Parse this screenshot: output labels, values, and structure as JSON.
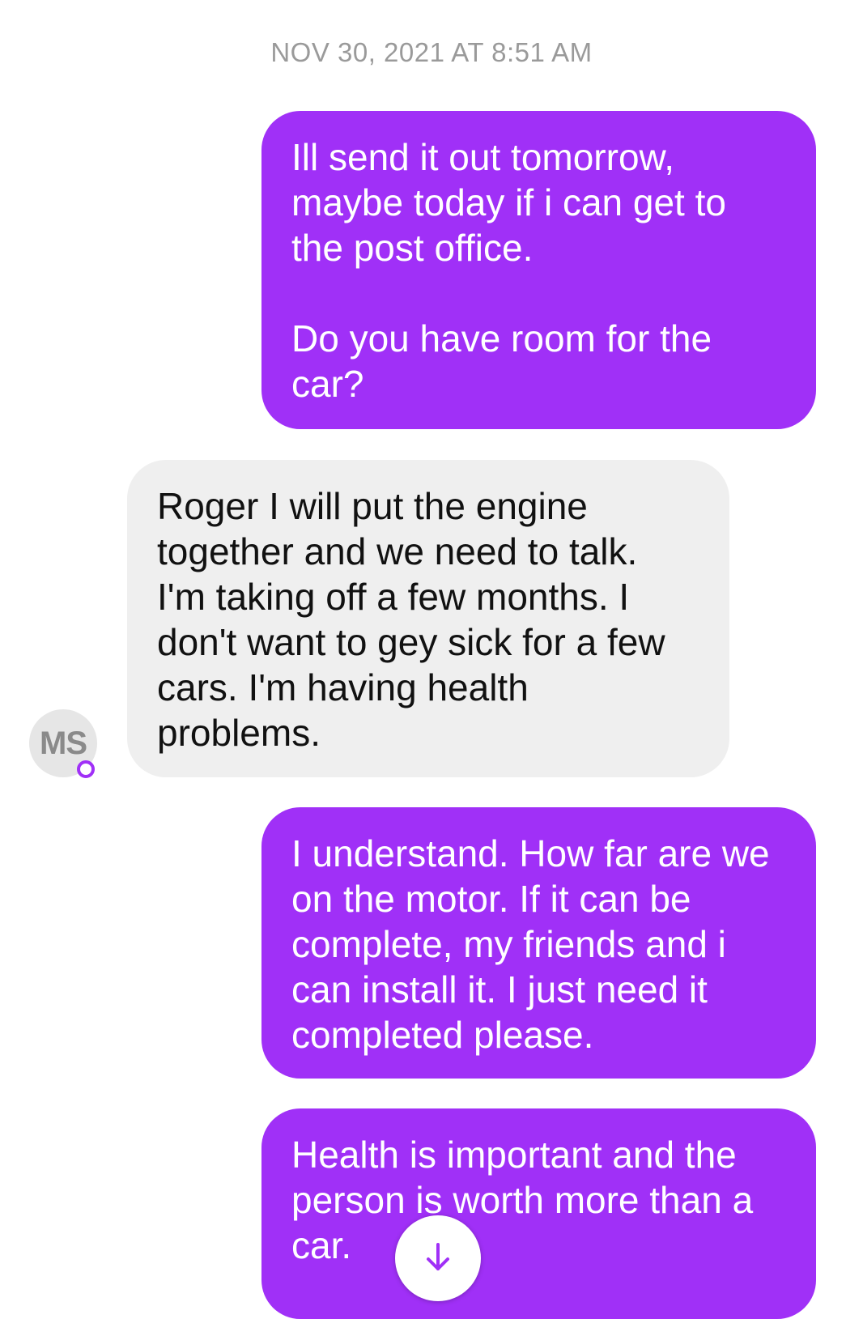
{
  "conversation": {
    "timestamp": "NOV 30, 2021 AT 8:51 AM",
    "messages": [
      {
        "direction": "outgoing",
        "text": "Ill send it out tomorrow,\nmaybe today if i can get to\nthe post office.\n\nDo you have room for the\ncar?"
      },
      {
        "direction": "incoming",
        "text": "Roger I will put the engine\ntogether and we need to talk.\nI'm taking off a few months. I\ndon't want to gey sick for a few\ncars. I'm having health\nproblems."
      },
      {
        "direction": "outgoing",
        "text": "I understand. How far are we\non the motor. If it can be\ncomplete, my friends and i\ncan install it. I just need it\ncompleted please."
      },
      {
        "direction": "outgoing",
        "text": "Health is important and the\nperson is worth more than a\ncar."
      }
    ]
  },
  "contact": {
    "initials": "MS",
    "status_icon": "presence-ring-icon"
  },
  "scroll_button": {
    "icon": "arrow-down-icon"
  },
  "colors": {
    "outgoing_bubble": "#a030f7",
    "incoming_bubble": "#efefef",
    "timestamp_text": "#9a9a9a"
  }
}
